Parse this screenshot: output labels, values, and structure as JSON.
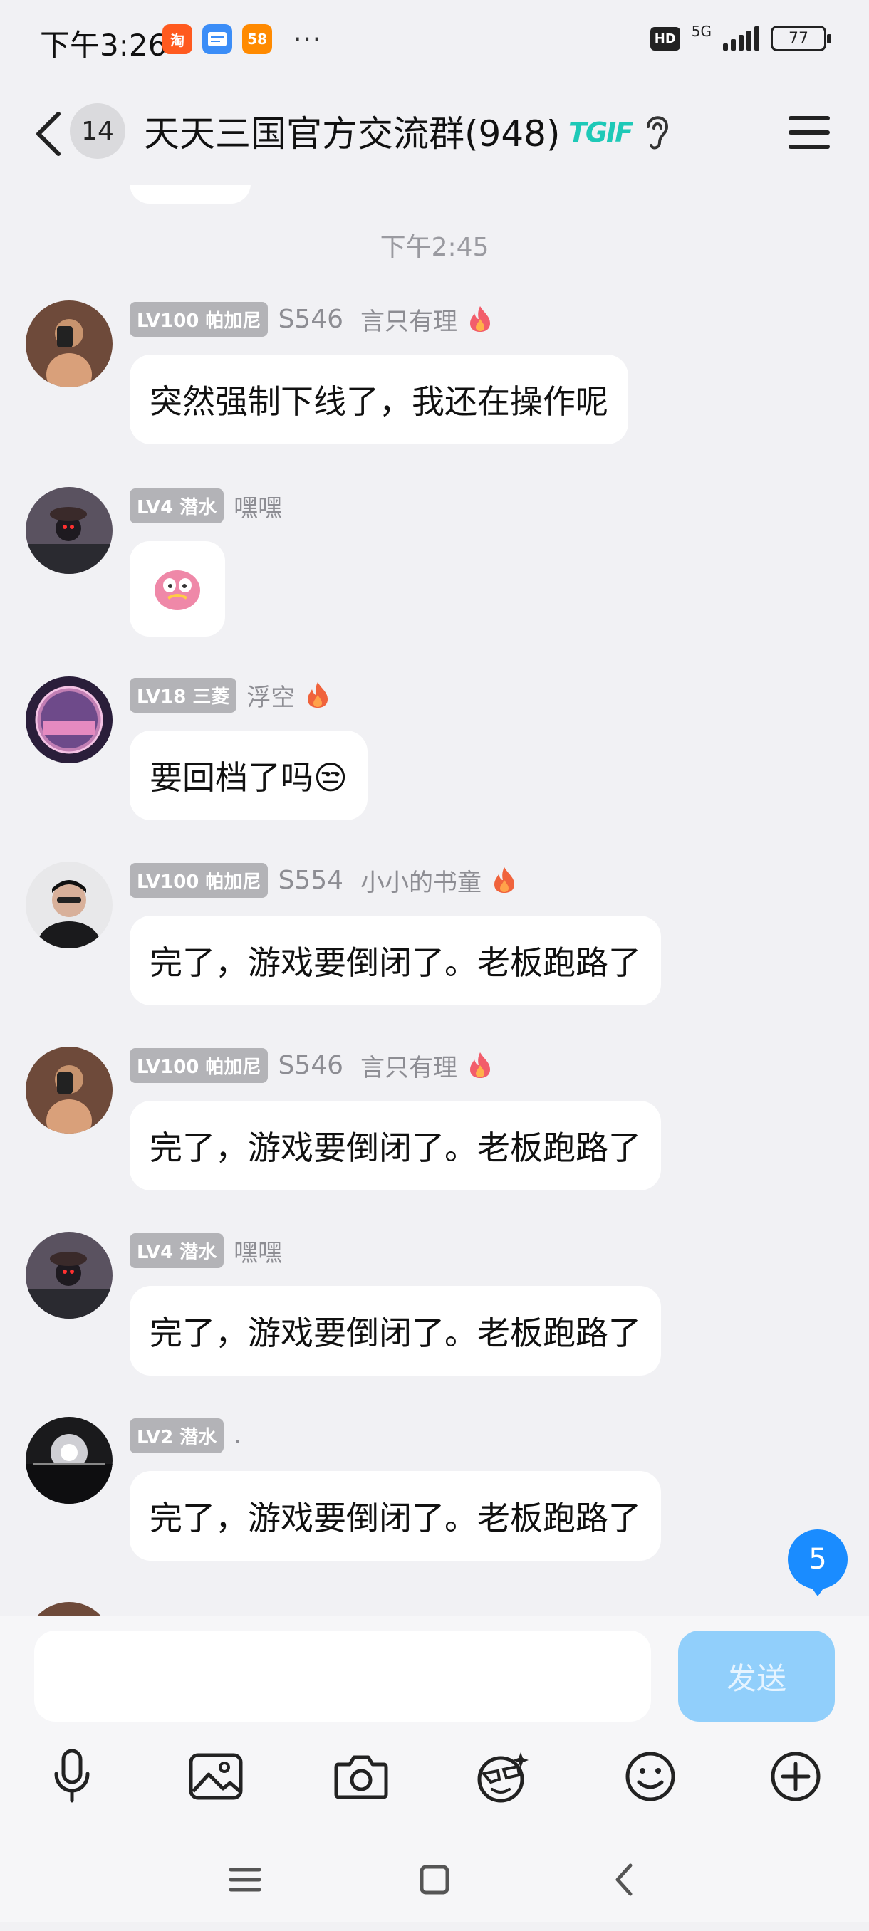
{
  "status_bar": {
    "time": "下午3:26",
    "more": "···",
    "network": "5G",
    "battery": "77",
    "apps": [
      {
        "icon": "taobao-app-icon",
        "label": "淘",
        "color": "#ff5a1f"
      },
      {
        "icon": "message-app-icon",
        "label": "",
        "color": "#3b8df7"
      },
      {
        "icon": "58-app-icon",
        "label": "58",
        "color": "#ff8a00"
      }
    ]
  },
  "header": {
    "unread_count": "14",
    "title": "天天三国官方交流群(948)",
    "badge": "TGIF"
  },
  "chat": {
    "time_separator": "下午2:45",
    "messages": [
      {
        "level": "LV100 帕加尼",
        "title": "S546",
        "nick": "言只有理",
        "text": "突然强制下线了，我还在操作呢",
        "avatar_color": "#7a5a48",
        "fire_color": "#f25d6b"
      },
      {
        "level": "LV4 潜水",
        "title": "",
        "nick": "嘿嘿",
        "text": "",
        "sticker": true,
        "avatar_color": "#4a4048",
        "fire_color": ""
      },
      {
        "level": "LV18 三菱",
        "title": "",
        "nick": "浮空",
        "text": "要回档了吗😒",
        "avatar_color": "#b06a9a",
        "fire_color": "#f0633c"
      },
      {
        "level": "LV100 帕加尼",
        "title": "S554",
        "nick": "小小的书童",
        "text": "完了，游戏要倒闭了。老板跑路了",
        "avatar_color": "#2d2d30",
        "fire_color": "#f0633c"
      },
      {
        "level": "LV100 帕加尼",
        "title": "S546",
        "nick": "言只有理",
        "text": "完了，游戏要倒闭了。老板跑路了",
        "avatar_color": "#7a5a48",
        "fire_color": "#f25d6b"
      },
      {
        "level": "LV4 潜水",
        "title": "",
        "nick": "嘿嘿",
        "text": "完了，游戏要倒闭了。老板跑路了",
        "avatar_color": "#4a4048",
        "fire_color": ""
      },
      {
        "level": "LV2 潜水",
        "title": "",
        "nick": ".",
        "text": "完了，游戏要倒闭了。老板跑路了",
        "avatar_color": "#1a1a1c",
        "fire_color": ""
      }
    ],
    "new_message_count": "5"
  },
  "composer": {
    "placeholder": "",
    "send_label": "发送"
  },
  "colors": {
    "accent": "#1a8cff",
    "send_disabled": "#91cffb",
    "badge_gray": "#b3b3b7",
    "background": "#f1f1f4"
  }
}
